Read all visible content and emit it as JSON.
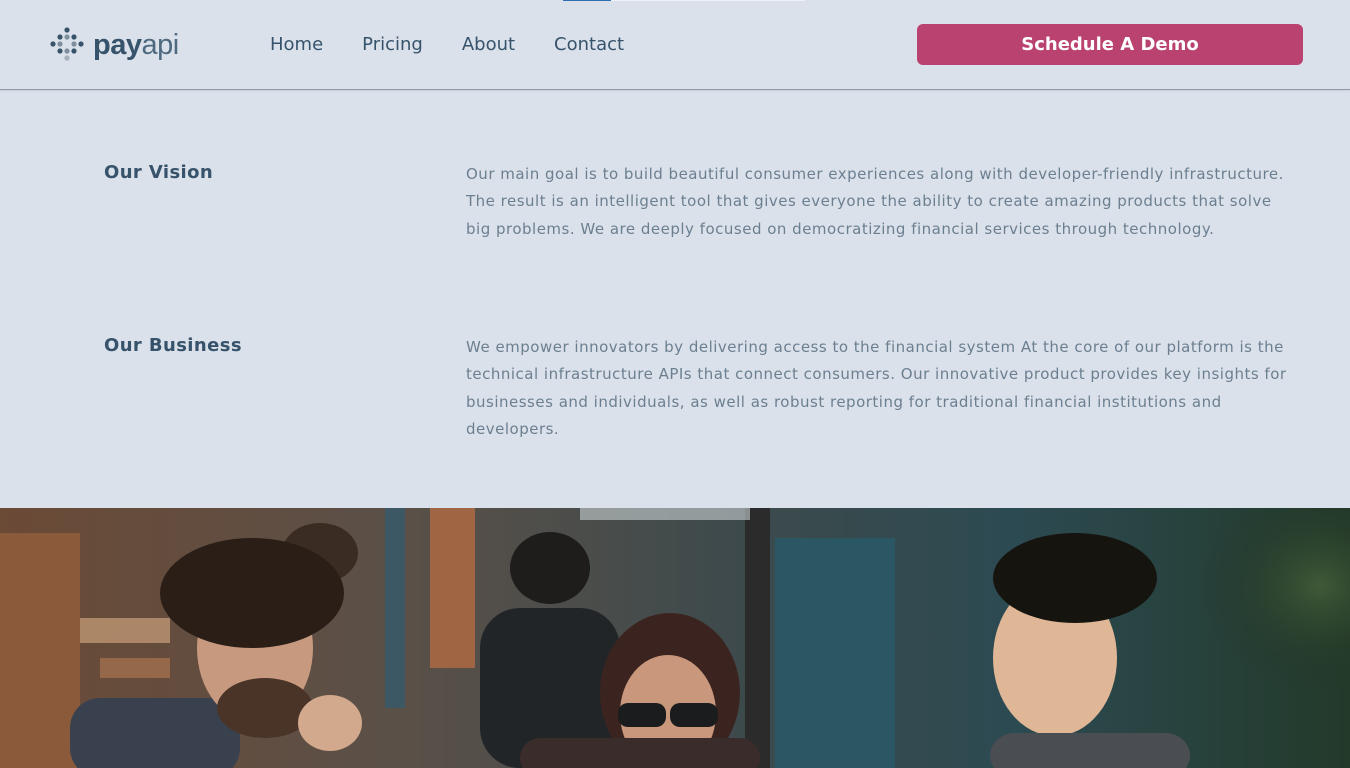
{
  "header": {
    "logo": {
      "bold_text": "pay",
      "light_text": "api"
    },
    "nav": [
      {
        "label": "Home"
      },
      {
        "label": "Pricing"
      },
      {
        "label": "About"
      },
      {
        "label": "Contact"
      }
    ],
    "cta_label": "Schedule A Demo"
  },
  "sections": [
    {
      "title": "Our Vision",
      "body": "Our main goal is to build beautiful consumer experiences along with developer-friendly infrastructure. The result is an intelligent tool that gives everyone the ability to create amazing products that solve big problems. We are deeply focused on democratizing financial services through technology."
    },
    {
      "title": "Our Business",
      "body": "We empower innovators by delivering access to the financial system At the core of our platform is the technical infrastructure APIs that connect consumers. Our innovative product provides key insights for businesses and individuals, as well as robust reporting for traditional financial institutions and developers."
    }
  ],
  "colors": {
    "background": "#dae1ea",
    "heading": "#36536b",
    "body_text": "#6c7f90",
    "accent": "#ba4270"
  }
}
